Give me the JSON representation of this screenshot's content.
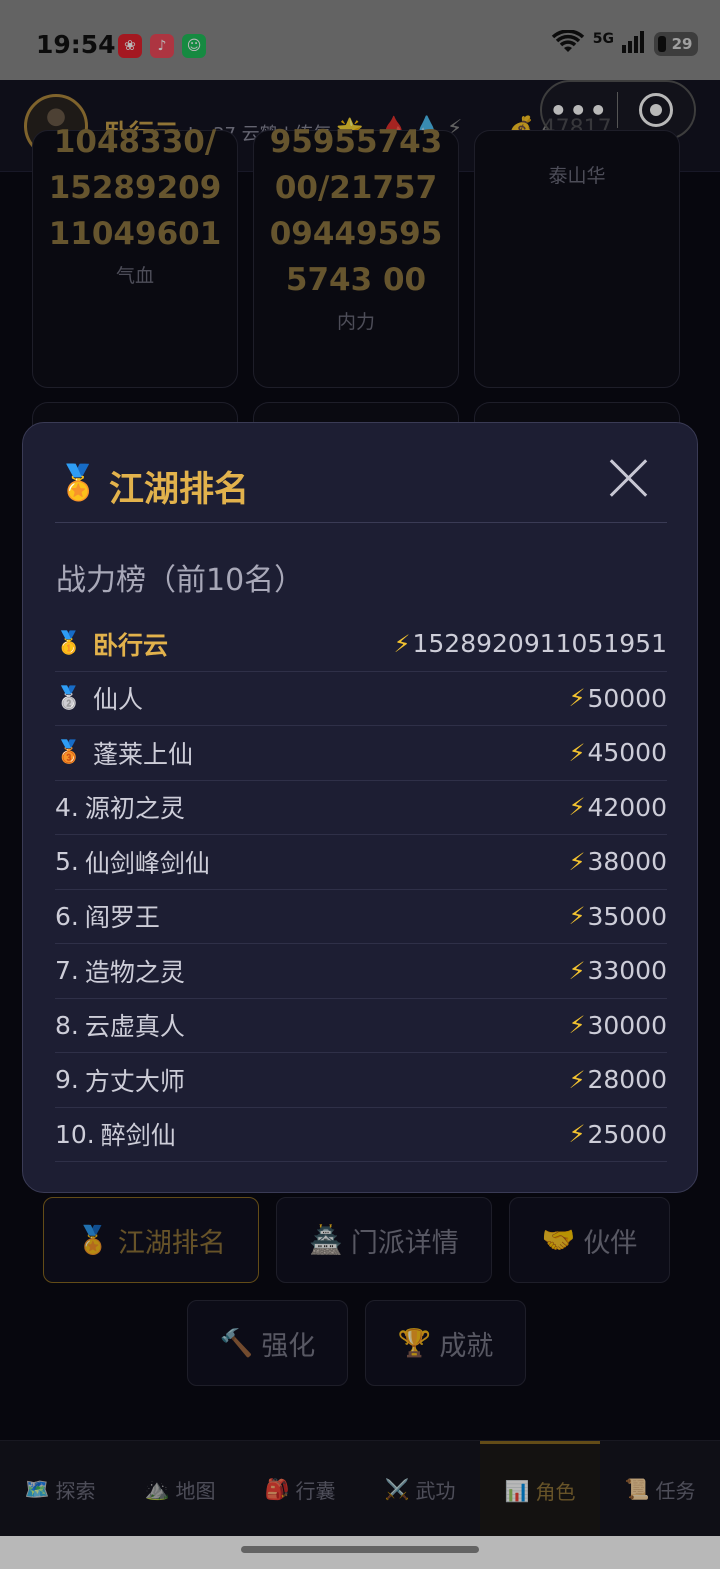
{
  "status_bar": {
    "time": "19:54",
    "network": "5G",
    "battery": "29"
  },
  "header": {
    "player_name": "卧行云",
    "level_text": "Lv.37 云鹤 | 练气",
    "gold": "47817"
  },
  "stat_cards": [
    {
      "value": "1048330/1528920911049601",
      "label": "气血"
    },
    {
      "value": "9595574300/21757094495955743 00",
      "label": "内力"
    },
    {
      "value": "",
      "label": "泰山华"
    }
  ],
  "modal": {
    "title": "江湖排名",
    "subtitle": "战力榜（前10名）",
    "rankings": [
      {
        "rank": "",
        "medal": "🥇",
        "name": "卧行云",
        "power": "1528920911051951"
      },
      {
        "rank": "",
        "medal": "🥈",
        "name": "仙人",
        "power": "50000"
      },
      {
        "rank": "",
        "medal": "🥉",
        "name": "蓬莱上仙",
        "power": "45000"
      },
      {
        "rank": "4.",
        "medal": "",
        "name": "源初之灵",
        "power": "42000"
      },
      {
        "rank": "5.",
        "medal": "",
        "name": "仙剑峰剑仙",
        "power": "38000"
      },
      {
        "rank": "6.",
        "medal": "",
        "name": "阎罗王",
        "power": "35000"
      },
      {
        "rank": "7.",
        "medal": "",
        "name": "造物之灵",
        "power": "33000"
      },
      {
        "rank": "8.",
        "medal": "",
        "name": "云虚真人",
        "power": "30000"
      },
      {
        "rank": "9.",
        "medal": "",
        "name": "方丈大师",
        "power": "28000"
      },
      {
        "rank": "10.",
        "medal": "",
        "name": "醉剑仙",
        "power": "25000"
      }
    ]
  },
  "action_buttons": {
    "ranking": "江湖排名",
    "sect": "门派详情",
    "partner": "伙伴",
    "enhance": "强化",
    "achievement": "成就"
  },
  "bottom_nav": [
    {
      "icon": "🗺️",
      "label": "探索"
    },
    {
      "icon": "⛰️",
      "label": "地图"
    },
    {
      "icon": "🎒",
      "label": "行囊"
    },
    {
      "icon": "⚔️",
      "label": "武功"
    },
    {
      "icon": "📊",
      "label": "角色"
    },
    {
      "icon": "📜",
      "label": "任务"
    }
  ]
}
